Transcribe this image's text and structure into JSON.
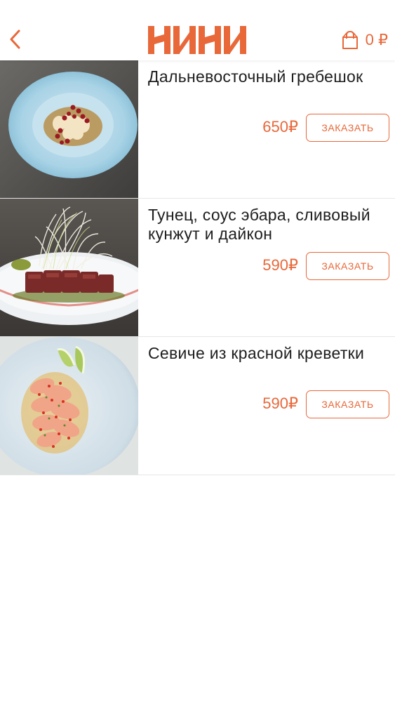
{
  "header": {
    "logo_text": "НИНИ",
    "cart_count": "0 ₽"
  },
  "items": [
    {
      "name": "Дальневосточный гребешок",
      "price": "650₽",
      "order_label": "ЗАКАЗАТЬ"
    },
    {
      "name": "Тунец, соус эбара, сливовый кунжут и дайкон",
      "price": "590₽",
      "order_label": "ЗАКАЗАТЬ"
    },
    {
      "name": "Севиче из красной креветки",
      "price": "590₽",
      "order_label": "ЗАКАЗАТЬ"
    }
  ],
  "colors": {
    "accent": "#e8683a",
    "text": "#1e1e1e",
    "divider": "#e6e6e6"
  }
}
